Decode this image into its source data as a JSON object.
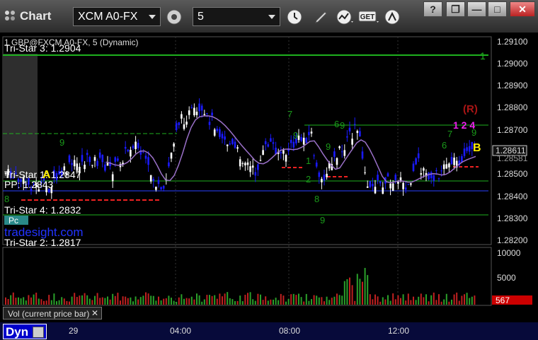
{
  "window": {
    "title": "Chart"
  },
  "toolbar": {
    "symbol": "XCM A0-FX",
    "interval": "5",
    "gear_icon": "gear-icon",
    "clock_icon": "clock-icon",
    "pencil_icon": "pencil-icon",
    "line_icon": "line-tool-icon",
    "get_label": "GET",
    "alert_icon": "alert-icon"
  },
  "window_buttons": {
    "help": "?",
    "restore": "❐",
    "minimize": "—",
    "maximize": "□",
    "close": "✕"
  },
  "chart": {
    "symbol_caption": "1 GBP@FXCM A0-FX, 5 (Dynamic)",
    "watermark": "tradesight.com",
    "price_axis": {
      "ticks": [
        "1.29100",
        "1.29000",
        "1.28900",
        "1.28800",
        "1.28700",
        "1.28600",
        "1.28500",
        "1.28400",
        "1.28300",
        "1.28200"
      ],
      "last": "1.28611",
      "prev": "1.28581"
    },
    "levels": [
      {
        "label": "Tri-Star 3: 1.2904"
      },
      {
        "label": "Tri-Star 1: 1.2847"
      },
      {
        "label": "PP: 1.2843"
      },
      {
        "label": "Tri-Star 4: 1.2832"
      },
      {
        "label": "Tri-Star 2: 1.2817"
      },
      {
        "label": "Pc"
      }
    ],
    "trade_marks": {
      "a": "A",
      "b": "B",
      "r": "(R)",
      "seq": "1 2 4",
      "one": "1"
    },
    "td_counts": [
      "9",
      "7",
      "9",
      "9",
      "6",
      "9",
      "1",
      "2",
      "8",
      "9",
      "6",
      "7",
      "9",
      "8"
    ],
    "volume": {
      "axis": [
        "10000",
        "5000"
      ],
      "last": "567",
      "label": "Vol (current price bar)",
      "close": "✕"
    },
    "time_axis": [
      "29",
      "04:00",
      "08:00",
      "12:00"
    ],
    "dyn_label": "Dyn",
    "colors": {
      "up": "#ffffff",
      "down": "#1a1aff",
      "ma": "#9a70c8",
      "level": "#1eb01e",
      "stop": "#ee2222"
    }
  }
}
